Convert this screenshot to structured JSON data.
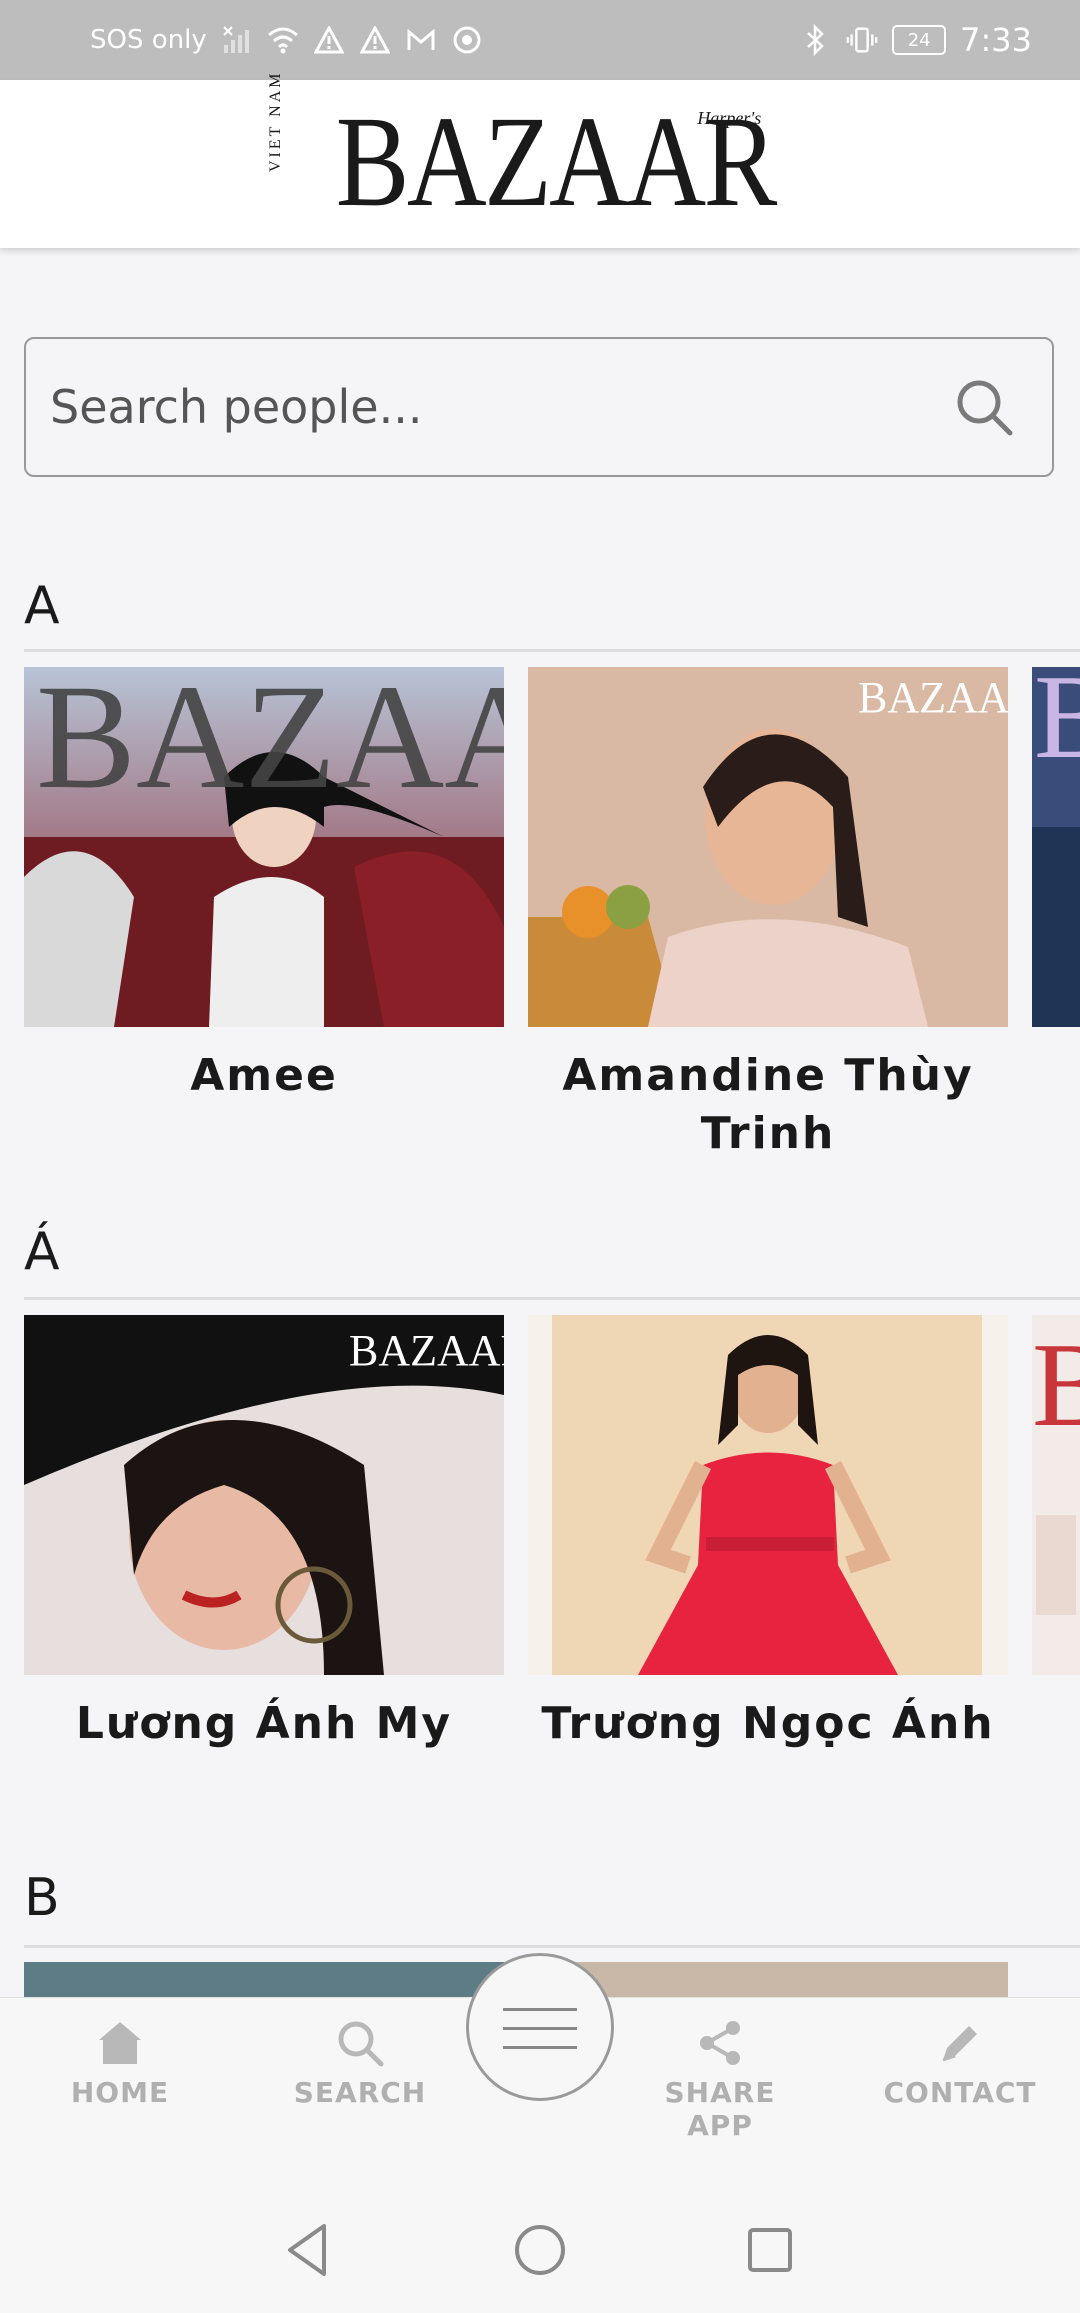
{
  "status_bar": {
    "carrier": "SOS only",
    "time": "7:33",
    "battery": "24"
  },
  "header": {
    "logo_text": "BAZAAR",
    "logo_harpers": "Harper's",
    "logo_country": "VIET NAM"
  },
  "search": {
    "placeholder": "Search people..."
  },
  "sections": [
    {
      "letter": "A",
      "people": [
        {
          "name": "Amee"
        },
        {
          "name": "Amandine Thùy Trinh"
        }
      ]
    },
    {
      "letter": "Á",
      "people": [
        {
          "name": "Lương Ánh My"
        },
        {
          "name": "Trương Ngọc Ánh"
        }
      ]
    },
    {
      "letter": "B",
      "people": []
    }
  ],
  "bottom_nav": {
    "home": "HOME",
    "search": "SEARCH",
    "share": "SHARE APP",
    "contact": "CONTACT"
  },
  "colors": {
    "status_bar": "#bdbdbd",
    "nav_inactive": "#b0b0b0",
    "background": "#f5f5f7"
  }
}
